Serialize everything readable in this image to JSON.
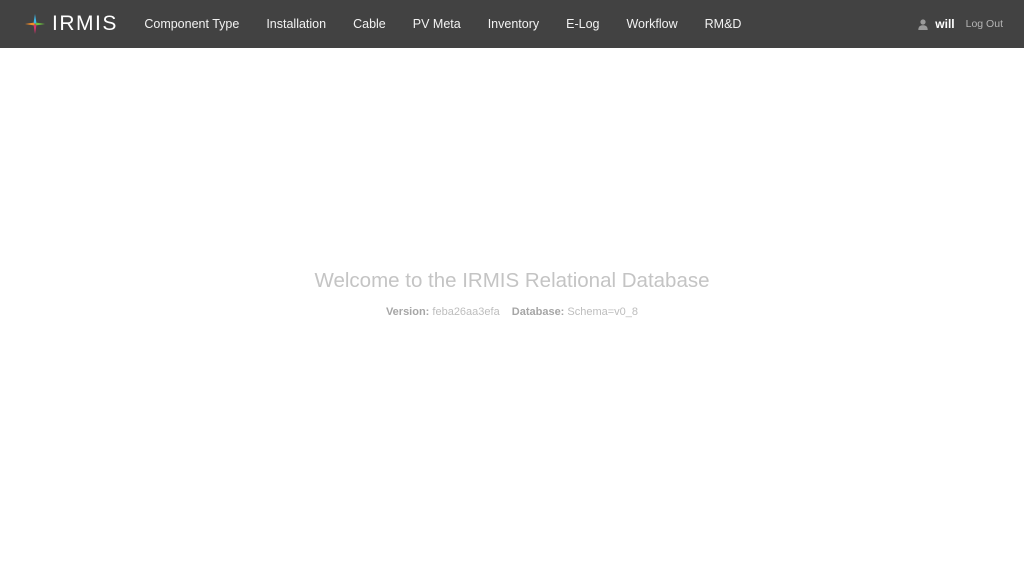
{
  "app": {
    "brand": "IRMIS"
  },
  "nav": {
    "items": [
      {
        "label": "Component Type"
      },
      {
        "label": "Installation"
      },
      {
        "label": "Cable"
      },
      {
        "label": "PV Meta"
      },
      {
        "label": "Inventory"
      },
      {
        "label": "E-Log"
      },
      {
        "label": "Workflow"
      },
      {
        "label": "RM&D"
      }
    ]
  },
  "user": {
    "icon": "user-icon",
    "name": "will",
    "logout_label": "Log Out"
  },
  "welcome": {
    "title": "Welcome to the IRMIS Relational Database",
    "version_label": "Version:",
    "version_value": "feba26aa3efa",
    "database_label": "Database:",
    "database_value": "Schema=v0_8"
  },
  "colors": {
    "navbar_bg": "#424242",
    "logo_cyan": "#3fb8e8",
    "logo_green": "#6cbf3f",
    "logo_magenta": "#d6336c",
    "logo_orange": "#f28c28"
  }
}
